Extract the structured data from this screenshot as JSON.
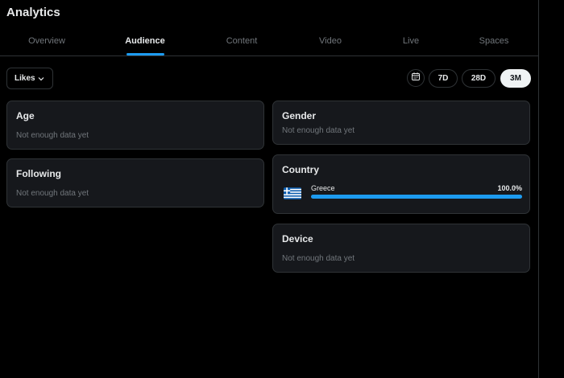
{
  "app": {
    "title": "Analytics"
  },
  "tabs": [
    {
      "label": "Overview",
      "active": false
    },
    {
      "label": "Audience",
      "active": true
    },
    {
      "label": "Content",
      "active": false
    },
    {
      "label": "Video",
      "active": false
    },
    {
      "label": "Live",
      "active": false
    },
    {
      "label": "Spaces",
      "active": false
    }
  ],
  "metric_select": {
    "value": "Likes",
    "icon": "chevron-down-icon"
  },
  "date_range": {
    "calendar_icon": "calendar-icon",
    "options": [
      "7D",
      "28D",
      "3M"
    ],
    "selected": "3M"
  },
  "cards": {
    "age": {
      "title": "Age",
      "empty": "Not enough data yet"
    },
    "following": {
      "title": "Following",
      "empty": "Not enough data yet"
    },
    "gender": {
      "title": "Gender",
      "empty": "Not enough data yet"
    },
    "country": {
      "title": "Country",
      "rows": [
        {
          "name": "Greece",
          "percent_label": "100.0%",
          "share": 1.0,
          "flag_icon": "greece-flag-icon"
        }
      ]
    },
    "device": {
      "title": "Device",
      "empty": "Not enough data yet"
    }
  },
  "colors": {
    "background": "#000000",
    "card": "#16181c",
    "border": "#2f3336",
    "accent": "#1d9bf0",
    "text_primary": "#e7e9ea",
    "text_secondary": "#71767b"
  }
}
